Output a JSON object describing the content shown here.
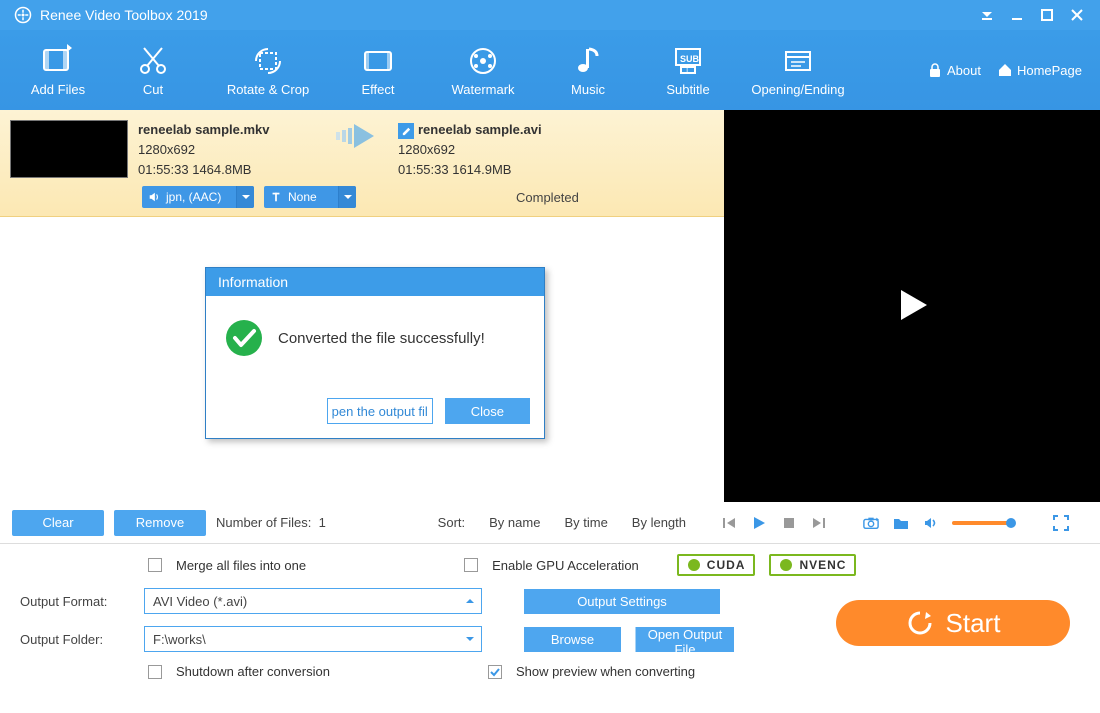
{
  "title": "Renee Video Toolbox 2019",
  "toolbar": {
    "add_files": "Add Files",
    "cut": "Cut",
    "rotate_crop": "Rotate & Crop",
    "effect": "Effect",
    "watermark": "Watermark",
    "music": "Music",
    "subtitle": "Subtitle",
    "opening_ending": "Opening/Ending"
  },
  "links": {
    "about": "About",
    "homepage": "HomePage"
  },
  "item": {
    "src_name": "reneelab sample.mkv",
    "src_res": "1280x692",
    "src_stat": "01:55:33 1464.8MB",
    "dst_name": "reneelab sample.avi",
    "dst_res": "1280x692",
    "dst_stat": "01:55:33 1614.9MB",
    "audio_track": "jpn,       (AAC)",
    "subtitle_track": "None",
    "status": "Completed"
  },
  "controls": {
    "clear": "Clear",
    "remove": "Remove",
    "count_label": "Number of Files:",
    "count": "1",
    "sort_label": "Sort:",
    "sort_name": "By name",
    "sort_time": "By time",
    "sort_length": "By length"
  },
  "options": {
    "merge": "Merge all files into one",
    "gpu": "Enable GPU Acceleration",
    "cuda": "CUDA",
    "nvenc": "NVENC",
    "format_label": "Output Format:",
    "format_value": "AVI Video (*.avi)",
    "output_settings": "Output Settings",
    "folder_label": "Output Folder:",
    "folder_value": "F:\\works\\",
    "browse": "Browse",
    "open_output": "Open Output File",
    "shutdown": "Shutdown after conversion",
    "show_preview": "Show preview when converting",
    "start": "Start"
  },
  "dialog": {
    "title": "Information",
    "message": "Converted the file successfully!",
    "open_btn": "pen the output fil",
    "close_btn": "Close"
  }
}
